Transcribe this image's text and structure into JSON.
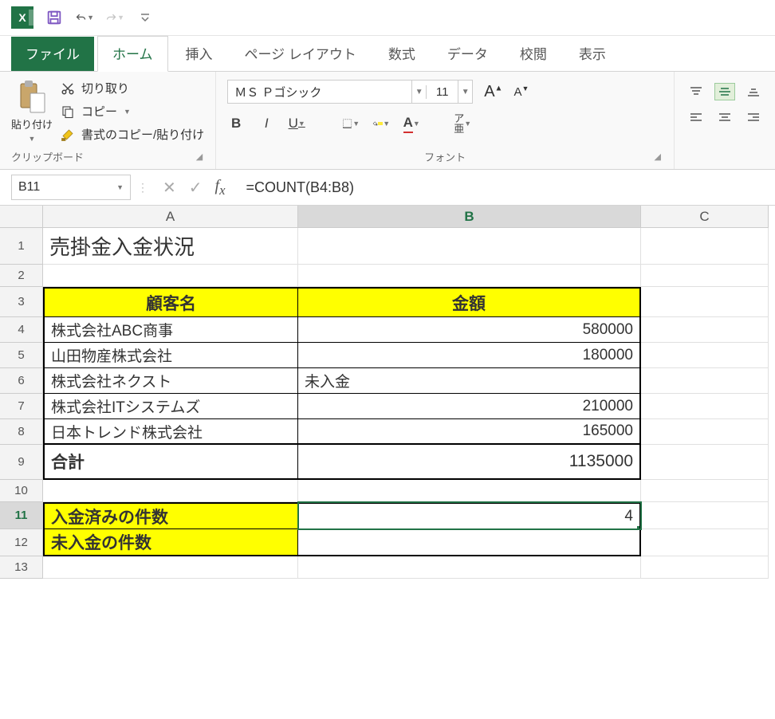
{
  "qat": {
    "logo_text": "X"
  },
  "tabs": {
    "file": "ファイル",
    "home": "ホーム",
    "insert": "挿入",
    "page_layout": "ページ レイアウト",
    "formulas": "数式",
    "data": "データ",
    "review": "校閲",
    "view": "表示"
  },
  "ribbon": {
    "clipboard": {
      "paste": "貼り付け",
      "cut": "切り取り",
      "copy": "コピー",
      "format_painter": "書式のコピー/貼り付け",
      "group_label": "クリップボード"
    },
    "font": {
      "name": "ＭＳ Ｐゴシック",
      "size": "11",
      "bold": "B",
      "italic": "I",
      "underline": "U",
      "furigana": "ア亜",
      "group_label": "フォント"
    }
  },
  "namebox": "B11",
  "formula": "=COUNT(B4:B8)",
  "columns": [
    "A",
    "B",
    "C"
  ],
  "row_numbers": [
    "1",
    "2",
    "3",
    "4",
    "5",
    "6",
    "7",
    "8",
    "9",
    "10",
    "11",
    "12",
    "13"
  ],
  "heights": {
    "r1": 46,
    "r2": 28,
    "r3": 38,
    "r4": 32,
    "r5": 32,
    "r6": 32,
    "r7": 32,
    "r8": 32,
    "r9": 44,
    "r10": 28,
    "r11": 34,
    "r12": 34,
    "r13": 28
  },
  "cells": {
    "title": "売掛金入金状況",
    "hdr_customer": "顧客名",
    "hdr_amount": "金額",
    "rows": [
      {
        "name": "株式会社ABC商事",
        "amount": "580000"
      },
      {
        "name": "山田物産株式会社",
        "amount": "180000"
      },
      {
        "name": "株式会社ネクスト",
        "amount": "未入金"
      },
      {
        "name": "株式会社ITシステムズ",
        "amount": "210000"
      },
      {
        "name": "日本トレンド株式会社",
        "amount": "165000"
      }
    ],
    "total_label": "合計",
    "total_value": "1135000",
    "paid_label": "入金済みの件数",
    "paid_value": "4",
    "unpaid_label": "未入金の件数",
    "unpaid_value": ""
  }
}
